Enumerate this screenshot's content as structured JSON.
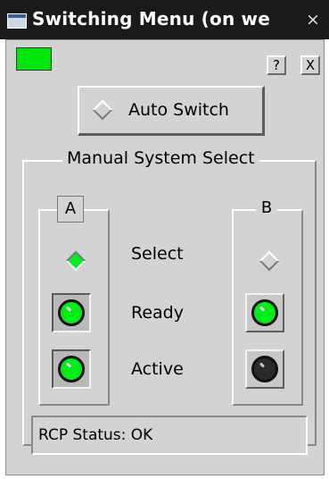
{
  "window": {
    "title": "Switching Menu (on we",
    "close_glyph": "×",
    "status_color": "#00e50a"
  },
  "toolbar": {
    "help_label": "?",
    "close_label": "X"
  },
  "auto_switch": {
    "label": "Auto Switch",
    "selected": false
  },
  "manual": {
    "title": "Manual System Select",
    "row_labels": {
      "select": "Select",
      "ready": "Ready",
      "active": "Active"
    },
    "system_a": {
      "label": "A",
      "selected": true,
      "ready": "green",
      "active": "green"
    },
    "system_b": {
      "label": "B",
      "selected": false,
      "ready": "green",
      "active": "off"
    }
  },
  "status": {
    "text": "RCP Status: OK"
  },
  "icons": {
    "title": "window-icon",
    "close": "close-icon",
    "radio": "diamond-radio-icon",
    "indicator": "led-indicator-icon"
  },
  "colors": {
    "led_green": "#00ee18",
    "led_off": "#2a2a2a",
    "panel": "#d3d3d3"
  }
}
